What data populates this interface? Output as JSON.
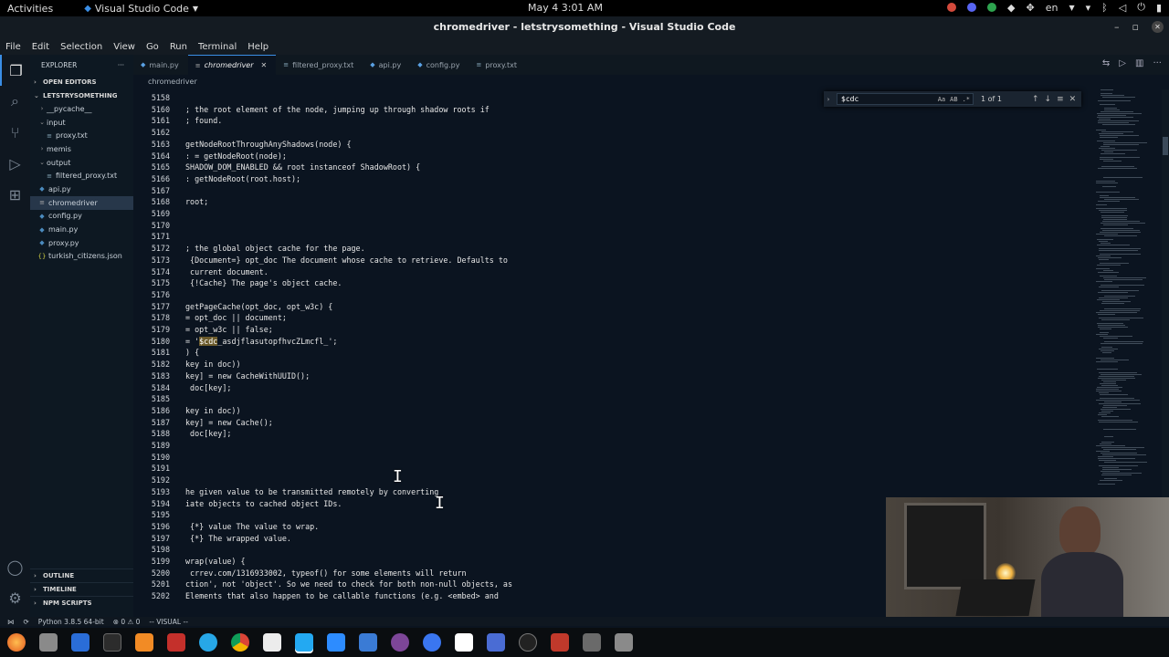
{
  "topbar": {
    "activities": "Activities",
    "app_name": "Visual Studio Code",
    "clock": "May 4  3:01 AM",
    "language": "en"
  },
  "window": {
    "title": "chromedriver - letstrysomething - Visual Studio Code"
  },
  "menubar": [
    "File",
    "Edit",
    "Selection",
    "View",
    "Go",
    "Run",
    "Terminal",
    "Help"
  ],
  "sidebar": {
    "header": "EXPLORER",
    "open_editors": "OPEN EDITORS",
    "project": "LETSTRYSOMETHING",
    "items": [
      {
        "label": "__pycache__",
        "type": "folder-collapsed"
      },
      {
        "label": "input",
        "type": "folder-open"
      },
      {
        "label": "proxy.txt",
        "type": "text"
      },
      {
        "label": "memis",
        "type": "folder-collapsed"
      },
      {
        "label": "output",
        "type": "folder-open"
      },
      {
        "label": "filtered_proxy.txt",
        "type": "text"
      },
      {
        "label": "api.py",
        "type": "python"
      },
      {
        "label": "chromedriver",
        "type": "file"
      },
      {
        "label": "config.py",
        "type": "python"
      },
      {
        "label": "main.py",
        "type": "python"
      },
      {
        "label": "proxy.py",
        "type": "python"
      },
      {
        "label": "turkish_citizens.json",
        "type": "json"
      }
    ],
    "outline": "OUTLINE",
    "timeline": "TIMELINE",
    "npm_scripts": "NPM SCRIPTS"
  },
  "tabs": [
    {
      "label": "main.py"
    },
    {
      "label": "chromedriver"
    },
    {
      "label": "filtered_proxy.txt"
    },
    {
      "label": "api.py"
    },
    {
      "label": "config.py"
    },
    {
      "label": "proxy.txt"
    }
  ],
  "breadcrumb": "chromedriver",
  "find": {
    "query": "$cdc",
    "result": "1 of 1",
    "opt_case": "Aa",
    "opt_word": "AB",
    "opt_regex": ".*"
  },
  "editor": {
    "lines": [
      {
        "n": "5158",
        "t": ""
      },
      {
        "n": "5160",
        "t": "; the root element of the node, jumping up through shadow roots if"
      },
      {
        "n": "5161",
        "t": "; found."
      },
      {
        "n": "5162",
        "t": ""
      },
      {
        "n": "5163",
        "t": "getNodeRootThroughAnyShadows(node) {"
      },
      {
        "n": "5164",
        "t": ": = getNodeRoot(node);"
      },
      {
        "n": "5165",
        "t": "SHADOW_DOM_ENABLED && root instanceof ShadowRoot) {"
      },
      {
        "n": "5166",
        "t": ": getNodeRoot(root.host);"
      },
      {
        "n": "5167",
        "t": ""
      },
      {
        "n": "5168",
        "t": "root;"
      },
      {
        "n": "5169",
        "t": ""
      },
      {
        "n": "5170",
        "t": ""
      },
      {
        "n": "5171",
        "t": ""
      },
      {
        "n": "5172",
        "t": "; the global object cache for the page."
      },
      {
        "n": "5173",
        "t": " {Document=} opt_doc The document whose cache to retrieve. Defaults to"
      },
      {
        "n": "5174",
        "t": " current document."
      },
      {
        "n": "5175",
        "t": " {!Cache} The page's object cache."
      },
      {
        "n": "5176",
        "t": ""
      },
      {
        "n": "5177",
        "t": "getPageCache(opt_doc, opt_w3c) {"
      },
      {
        "n": "5178",
        "t": "= opt_doc || document;"
      },
      {
        "n": "5179",
        "t": "= opt_w3c || false;"
      },
      {
        "n": "5180",
        "t": "= '",
        "hl": "$cdc",
        "rest": "_asdjflasutopfhvcZLmcfl_';"
      },
      {
        "n": "5181",
        "t": ") {"
      },
      {
        "n": "5182",
        "t": "key in doc))"
      },
      {
        "n": "5183",
        "t": "key] = new CacheWithUUID();"
      },
      {
        "n": "5184",
        "t": " doc[key];"
      },
      {
        "n": "5185",
        "t": ""
      },
      {
        "n": "5186",
        "t": "key in doc))"
      },
      {
        "n": "5187",
        "t": "key] = new Cache();"
      },
      {
        "n": "5188",
        "t": " doc[key];"
      },
      {
        "n": "5189",
        "t": ""
      },
      {
        "n": "5190",
        "t": ""
      },
      {
        "n": "5191",
        "t": ""
      },
      {
        "n": "5192",
        "t": ""
      },
      {
        "n": "5193",
        "t": "he given value to be transmitted remotely by converting"
      },
      {
        "n": "5194",
        "t": "iate objects to cached object IDs."
      },
      {
        "n": "5195",
        "t": ""
      },
      {
        "n": "5196",
        "t": " {*} value The value to wrap."
      },
      {
        "n": "5197",
        "t": " {*} The wrapped value."
      },
      {
        "n": "5198",
        "t": ""
      },
      {
        "n": "5199",
        "t": "wrap(value) {"
      },
      {
        "n": "5200",
        "t": " crrev.com/1316933002, typeof() for some elements will return"
      },
      {
        "n": "5201",
        "t": "ction', not 'object'. So we need to check for both non-null objects, as"
      },
      {
        "n": "5202",
        "t": "Elements that also happen to be callable functions (e.g. <embed> and"
      }
    ]
  },
  "statusbar": {
    "python": "Python 3.8.5 64-bit",
    "problems": "⊗ 0 ⚠ 0",
    "mode": "-- VISUAL --"
  },
  "colors": {
    "accent": "#3a8ee6",
    "editor_bg": "#0b1420",
    "highlight": "#6b5a2b"
  }
}
